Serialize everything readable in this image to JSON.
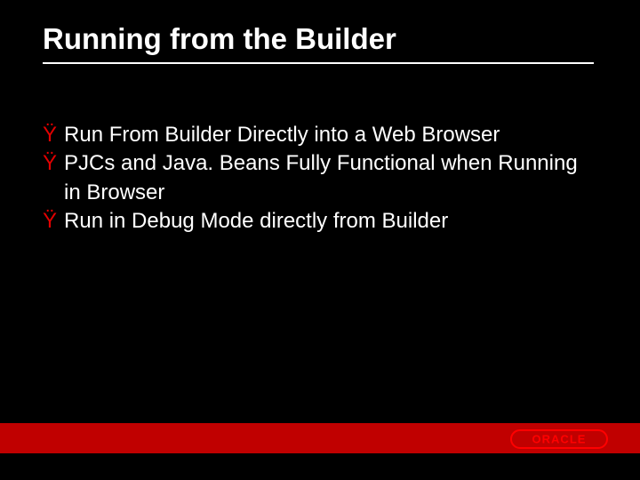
{
  "title": "Running from the Builder",
  "bullets": [
    {
      "marker": "Ÿ",
      "text": "Run From Builder Directly into a Web Browser"
    },
    {
      "marker": "Ÿ",
      "text": "PJCs and Java. Beans Fully Functional when Running in Browser"
    },
    {
      "marker": "Ÿ",
      "text": "Run in Debug Mode directly from Builder"
    }
  ],
  "logo_text": "ORACLE",
  "colors": {
    "accent": "#c00000",
    "bullet_marker": "#e20000",
    "background": "#000000",
    "text": "#ffffff"
  }
}
